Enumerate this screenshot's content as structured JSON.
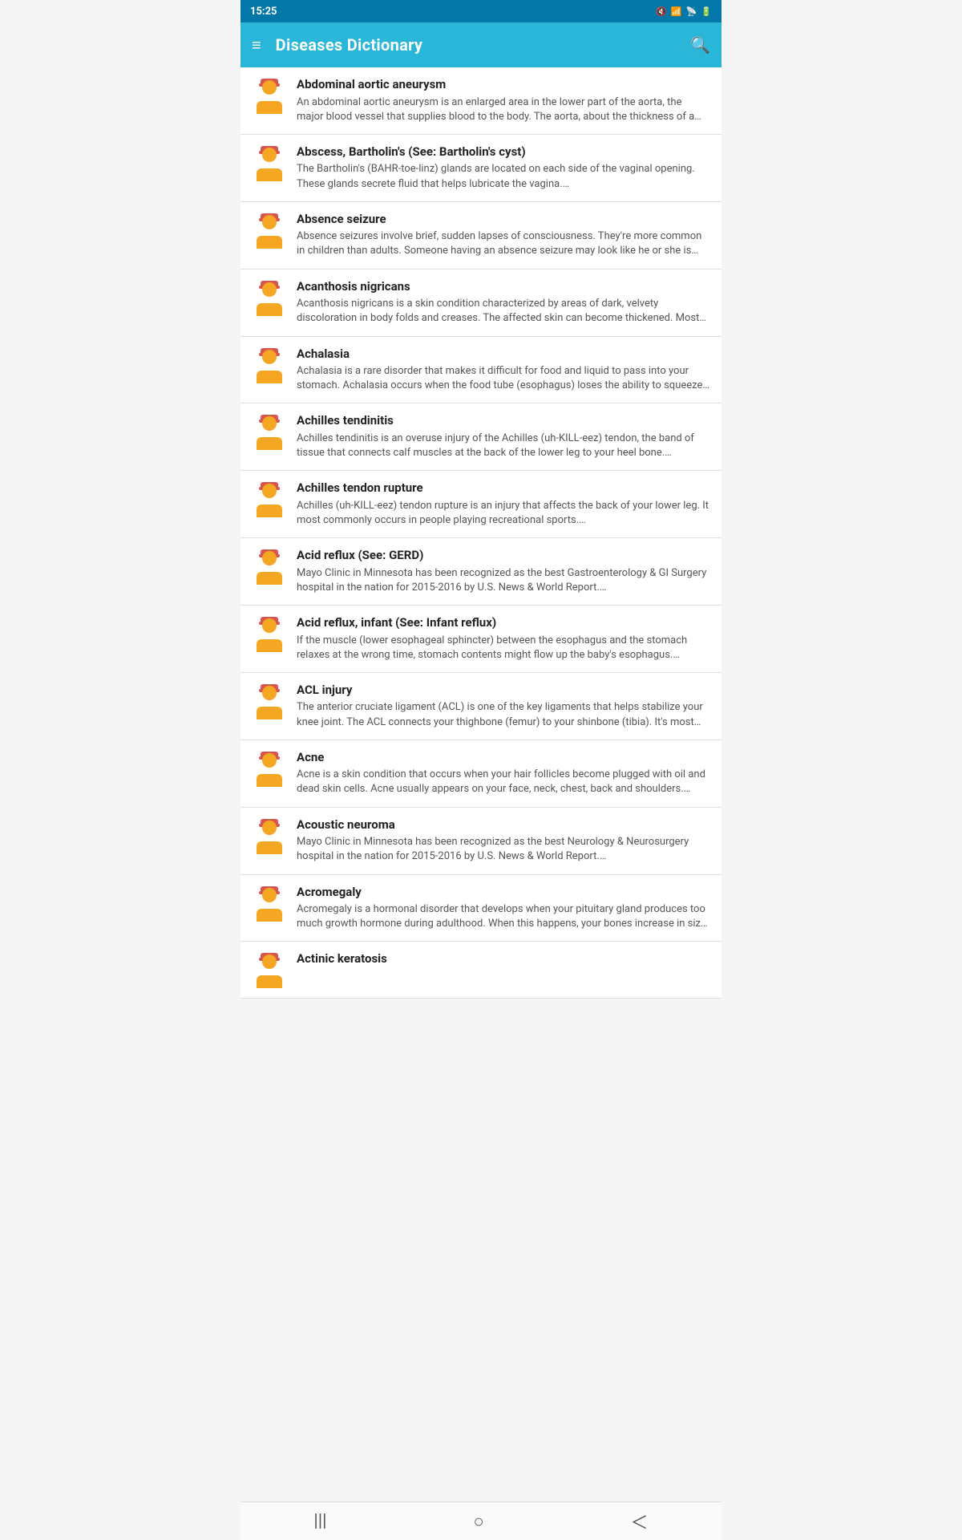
{
  "statusBar": {
    "time": "15:25",
    "icons": [
      "mute",
      "wifi",
      "signal",
      "battery"
    ]
  },
  "appBar": {
    "title": "Diseases Dictionary",
    "menuIcon": "≡",
    "searchIcon": "🔍"
  },
  "diseases": [
    {
      "name": "Abdominal aortic aneurysm",
      "desc": "An abdominal aortic aneurysm is an enlarged area in the lower part of the aorta, the major blood vessel that supplies blood to the body. The aorta, about the thickness of a garden hose, runs from your heart through the center of your che…"
    },
    {
      "name": "Abscess, Bartholin's (See: Bartholin's cyst)",
      "desc": "The Bartholin's (BAHR-toe-linz) glands are located on each side of the vaginal opening. These glands secrete fluid that helps lubricate the vagina.…"
    },
    {
      "name": "Absence seizure",
      "desc": "Absence seizures involve brief, sudden lapses of consciousness. They're more common in children than adults. Someone having an absence seizure may look like he or she is staring into space for a few seconds. This type of seizur…"
    },
    {
      "name": "Acanthosis nigricans",
      "desc": "Acanthosis nigricans is a skin condition characterized by areas of dark, velvety discoloration in body folds and creases. The affected skin can become thickened. Most often, acanthosis nigricans affects your armpits, groin and neck.…"
    },
    {
      "name": "Achalasia",
      "desc": "Achalasia is a rare disorder that makes it difficult for food and liquid to pass into your stomach. Achalasia occurs when the food tube (esophagus) loses the ability to squeeze food down, and the muscular valve between the esophagus and …"
    },
    {
      "name": "Achilles tendinitis",
      "desc": "Achilles tendinitis is an overuse injury of the Achilles (uh-KILL-eez) tendon, the band of tissue that connects calf muscles at the back of the lower leg to your heel bone.…"
    },
    {
      "name": "Achilles tendon rupture",
      "desc": "Achilles (uh-KILL-eez) tendon rupture is an injury that affects the back of your lower leg. It most commonly occurs in people playing recreational sports.…"
    },
    {
      "name": "Acid reflux (See: GERD)",
      "desc": "Mayo Clinic in Minnesota has been recognized as the best Gastroenterology & GI Surgery hospital in the nation for 2015-2016 by U.S. News & World Report.…"
    },
    {
      "name": "Acid reflux, infant (See: Infant reflux)",
      "desc": "If the muscle (lower esophageal sphincter) between the esophagus and the stomach relaxes at the wrong time, stomach contents might flow up the baby's esophagus.…"
    },
    {
      "name": "ACL injury",
      "desc": "The anterior cruciate ligament (ACL) is one of the key ligaments that helps stabilize your knee joint. The ACL connects your thighbone (femur) to your shinbone (tibia). It's most commonly torn during sports that involve sudden stops, jumpi…"
    },
    {
      "name": "Acne",
      "desc": "Acne is a skin condition that occurs when your hair follicles become plugged with oil and dead skin cells. Acne usually appears on your face, neck, chest, back and shoulders. Effective treatments are available, but acne can be persistent. T…"
    },
    {
      "name": "Acoustic neuroma",
      "desc": "Mayo Clinic in Minnesota has been recognized as the best Neurology & Neurosurgery hospital in the nation for 2015-2016 by U.S. News & World Report.…"
    },
    {
      "name": "Acromegaly",
      "desc": "Acromegaly is a hormonal disorder that develops when your pituitary gland produces too much growth hormone during adulthood. When this happens, your bones increase in size, including those of your hands, feet and face. Acromegaly us…"
    },
    {
      "name": "Actinic keratosis",
      "desc": ""
    }
  ],
  "navBar": {
    "back": "◁",
    "home": "○",
    "recents": "▭"
  }
}
